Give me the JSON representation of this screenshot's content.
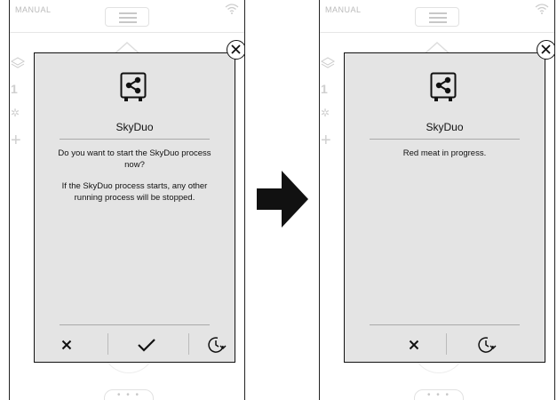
{
  "left_screen": {
    "status": {
      "mode_label": "MANUAL"
    },
    "dialog": {
      "title": "SkyDuo",
      "message_line1": "Do you want to start the SkyDuo process now?",
      "message_line2": "If the SkyDuo process starts, any other running process will be stopped.",
      "actions": [
        "cancel",
        "confirm",
        "delay-start"
      ]
    },
    "background": {
      "ghost_number": "1",
      "bottom_tab_dots": "• • •"
    }
  },
  "right_screen": {
    "status": {
      "mode_label": "MANUAL"
    },
    "dialog": {
      "title": "SkyDuo",
      "message": "Red meat in progress.",
      "actions": [
        "cancel",
        "delay-start"
      ]
    },
    "background": {
      "ghost_number": "1",
      "bottom_tab_dots": "• • •"
    }
  },
  "colors": {
    "panel": "#e4e4e4",
    "stroke": "#111111",
    "ghost": "#cccccc"
  },
  "icons": [
    "close-icon",
    "skyduo-share-icon",
    "x-icon",
    "check-icon",
    "clock-icon",
    "arrow-right-icon",
    "wifi-icon",
    "hamburger-icon",
    "home-icon"
  ]
}
